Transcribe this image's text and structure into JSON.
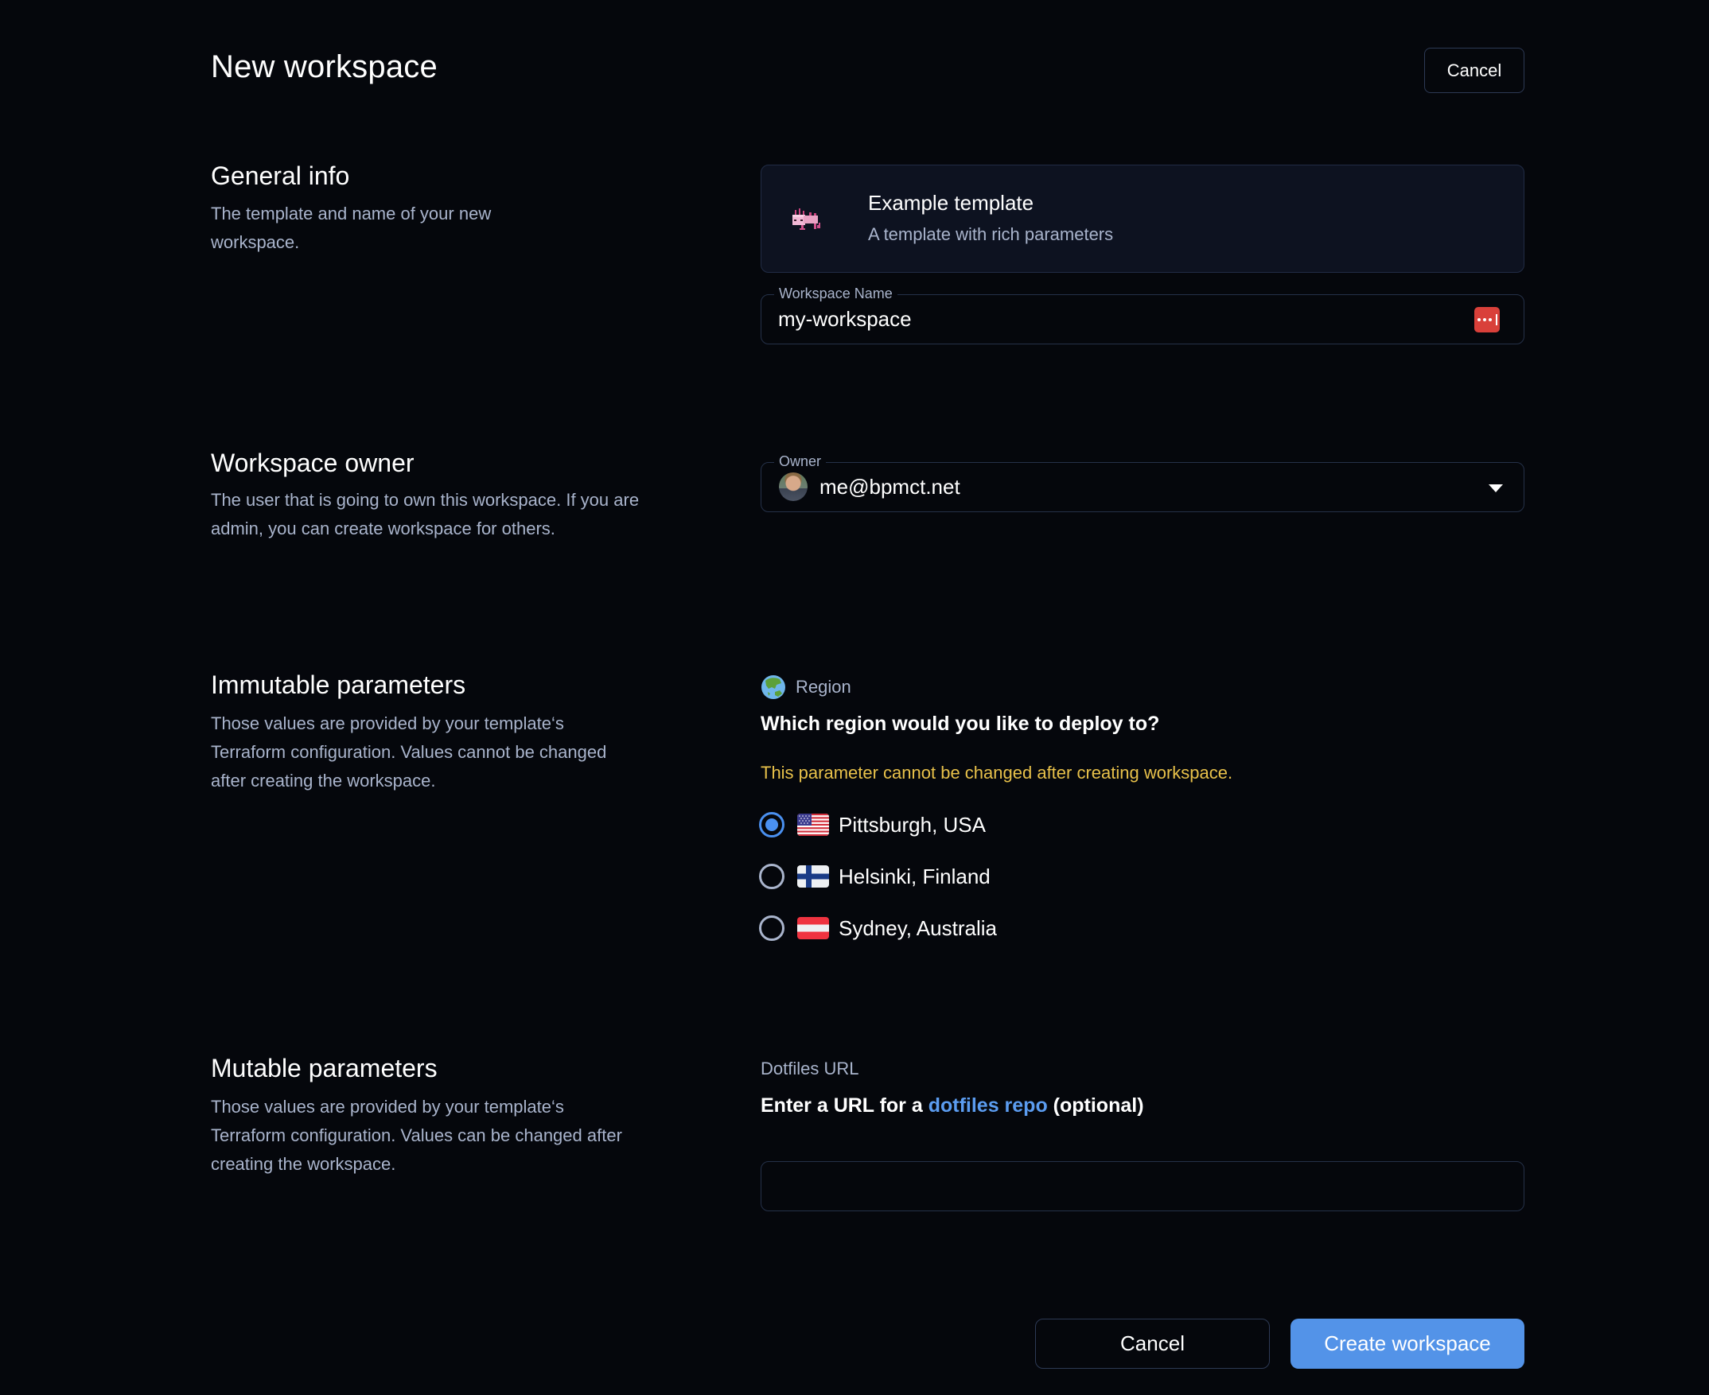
{
  "header": {
    "title": "New workspace",
    "cancel_label": "Cancel"
  },
  "sections": {
    "general": {
      "heading": "General info",
      "description": "The template and name of your new workspace."
    },
    "owner": {
      "heading": "Workspace owner",
      "description": "The user that is going to own this workspace. If you are admin, you can create workspace for others."
    },
    "immutable": {
      "heading": "Immutable parameters",
      "description": "Those values are provided by your template‘s Terraform configuration. Values cannot be changed after creating the workspace."
    },
    "mutable": {
      "heading": "Mutable parameters",
      "description": "Those values are provided by your template‘s Terraform configuration. Values can be changed after creating the workspace."
    }
  },
  "template": {
    "icon": "axolotl-icon",
    "name": "Example template",
    "description": "A template with rich parameters"
  },
  "workspace_name": {
    "label": "Workspace Name",
    "value": "my-workspace",
    "autofill_icon": "lastpass-icon"
  },
  "owner_field": {
    "label": "Owner",
    "value": "me@bpmct.net",
    "avatar": "user-avatar"
  },
  "region_param": {
    "icon": "globe-icon",
    "label": "Region",
    "question": "Which region would you like to deploy to?",
    "warning": "This parameter cannot be changed after creating workspace.",
    "selected": "Pittsburgh, USA",
    "options": [
      {
        "label": "Pittsburgh, USA",
        "flag": "us-flag",
        "checked": true
      },
      {
        "label": "Helsinki, Finland",
        "flag": "fi-flag",
        "checked": false
      },
      {
        "label": "Sydney, Australia",
        "flag": "red-white-red-flag",
        "checked": false
      }
    ]
  },
  "dotfiles_param": {
    "label": "Dotfiles URL",
    "prompt_prefix": "Enter a URL for a ",
    "prompt_link": "dotfiles repo",
    "prompt_suffix": " (optional)",
    "value": "",
    "placeholder": ""
  },
  "footer": {
    "cancel_label": "Cancel",
    "create_label": "Create workspace"
  },
  "colors": {
    "background": "#05070c",
    "accent": "#5393e8",
    "warning": "#e8c14a",
    "muted_text": "#a9b4cc",
    "border": "#253149"
  }
}
